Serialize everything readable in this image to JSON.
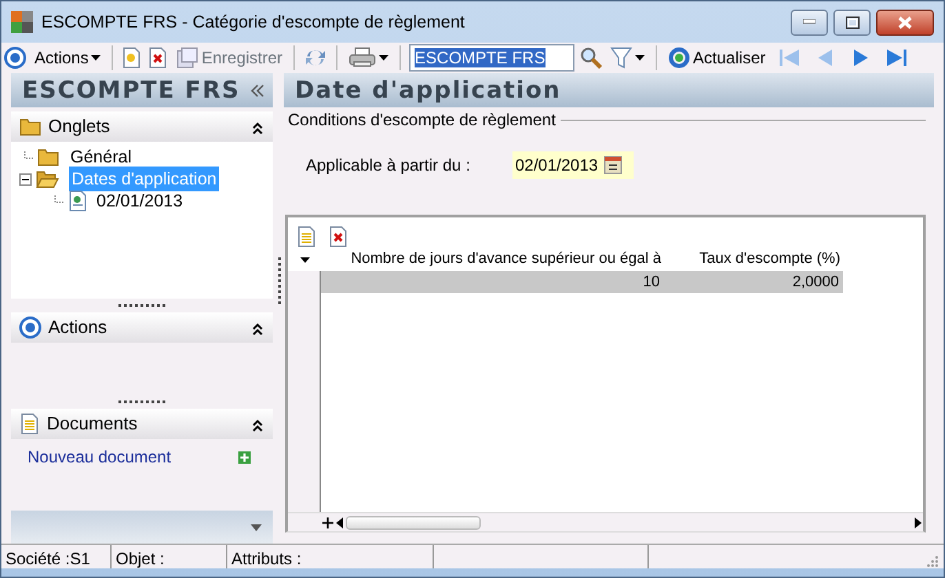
{
  "window": {
    "title": "ESCOMPTE FRS -  Catégorie d'escompte de règlement"
  },
  "toolbar": {
    "actions_label": "Actions",
    "save_label": "Enregistrer",
    "search_value": "ESCOMPTE FRS",
    "refresh_label": "Actualiser"
  },
  "sidebar": {
    "title": "ESCOMPTE FRS",
    "sections": [
      {
        "kind": "tree",
        "title": "Onglets",
        "tree": [
          {
            "label": "Général",
            "selected": false
          },
          {
            "label": "Dates d'application",
            "selected": true,
            "expanded": true,
            "children": [
              {
                "label": "02/01/2013",
                "selected": false
              }
            ]
          }
        ]
      },
      {
        "kind": "empty",
        "title": "Actions"
      },
      {
        "kind": "links",
        "title": "Documents",
        "links": [
          "Nouveau document"
        ]
      }
    ]
  },
  "panel": {
    "title": "Date d'application",
    "group_title": "Conditions d'escompte de règlement",
    "field": {
      "label": "Applicable à partir du :",
      "value": "02/01/2013"
    },
    "table": {
      "columns": [
        "Nombre de jours d'avance supérieur ou égal à",
        "Taux d'escompte (%)"
      ],
      "rows": [
        {
          "cells": [
            "10",
            "2,0000"
          ],
          "selected": true
        }
      ]
    }
  },
  "status_bar": [
    "Société :S1",
    "Objet :",
    "Attributs :"
  ]
}
